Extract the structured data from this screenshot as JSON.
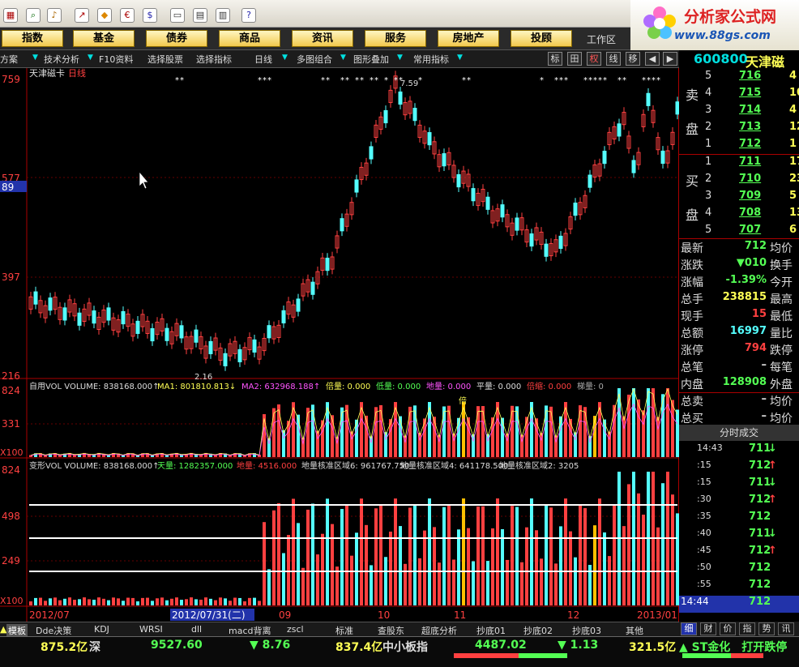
{
  "colors": {
    "up": "#ff4040",
    "down": "#54ffff",
    "ma1": "#ffff55",
    "ma2": "#ff55ff",
    "gold": "#ffc000"
  },
  "logo": {
    "title": "分析家公式网",
    "url": "www.88gs.com"
  },
  "menu": [
    "指数",
    "基金",
    "债券",
    "商品",
    "资讯",
    "服务",
    "房地产",
    "投顾"
  ],
  "workarea": "工作区",
  "tabs": [
    "方案",
    "技术分析",
    "F10资料",
    "选择股票",
    "选择指标",
    "日线",
    "多图组合",
    "图形叠加",
    "常用指标"
  ],
  "tab_tools": [
    "标",
    "田",
    "权",
    "线",
    "移",
    "◀",
    "▶"
  ],
  "stock": {
    "code": "600800",
    "name": "天津磁"
  },
  "chart": {
    "title": "天津磁卡",
    "period": "日线",
    "price_ticks": [
      "759",
      "577",
      "397",
      "216"
    ],
    "price_marker": "89",
    "high_label": "7.59",
    "low_label": "2.16",
    "vol_ticks": [
      "824",
      "331",
      "X100"
    ],
    "vol2_ticks": [
      "824",
      "498",
      "249",
      "X100"
    ],
    "vol_header": [
      "自用VOL VOLUME: 838168.000↑",
      "MA1: 801810.813↓",
      "MA2: 632968.188↑",
      "倍量: 0.000",
      "低量: 0.000",
      "地量: 0.000",
      "平量: 0.000",
      "倍缩: 0.000",
      "梯量: 0"
    ],
    "vol2_header": [
      "变形VOL VOLUME: 838168.000↑",
      "天量: 1282357.000",
      "地量: 4516.000",
      "地量核准区域6: 961767.750",
      "地量核准区域4: 641178.500",
      "地量核准区域2: 3205"
    ],
    "bei_label": "倍",
    "x_labels": [
      "2012/07",
      "2012/07/31(二)",
      "09",
      "10",
      "11",
      "12",
      "2013/01"
    ]
  },
  "orderbook": {
    "sell_label": [
      "卖",
      "盘"
    ],
    "buy_label": [
      "买",
      "盘"
    ],
    "sell": [
      {
        "idx": "5",
        "price": "716",
        "vol": "4"
      },
      {
        "idx": "4",
        "price": "715",
        "vol": "10"
      },
      {
        "idx": "3",
        "price": "714",
        "vol": "4"
      },
      {
        "idx": "2",
        "price": "713",
        "vol": "12"
      },
      {
        "idx": "1",
        "price": "712",
        "vol": "1"
      }
    ],
    "buy": [
      {
        "idx": "1",
        "price": "711",
        "vol": "17"
      },
      {
        "idx": "2",
        "price": "710",
        "vol": "23"
      },
      {
        "idx": "3",
        "price": "709",
        "vol": "5"
      },
      {
        "idx": "4",
        "price": "708",
        "vol": "13"
      },
      {
        "idx": "5",
        "price": "707",
        "vol": "6"
      }
    ]
  },
  "quote": [
    {
      "label": "最新",
      "value": "712",
      "color": "#54ff54",
      "tail": "均价"
    },
    {
      "label": "涨跌",
      "value": "▼010",
      "color": "#54ff54",
      "tail": "换手"
    },
    {
      "label": "涨幅",
      "value": "-1.39%",
      "color": "#54ff54",
      "tail": "今开"
    },
    {
      "label": "总手",
      "value": "238815",
      "color": "#ffff55",
      "tail": "最高"
    },
    {
      "label": "现手",
      "value": "15",
      "color": "#ff4040",
      "tail": "最低"
    },
    {
      "label": "总额",
      "value": "16997",
      "color": "#54ffff",
      "tail": "量比"
    },
    {
      "label": "涨停",
      "value": "794",
      "color": "#ff4040",
      "tail": "跌停"
    },
    {
      "label": "总笔",
      "value": "–",
      "color": "#ddd",
      "tail": "每笔"
    },
    {
      "label": "内盘",
      "value": "128908",
      "color": "#54ff54",
      "tail": "外盘"
    },
    {
      "label": "总卖",
      "value": "–",
      "color": "#ddd",
      "tail": "均价"
    },
    {
      "label": "总买",
      "value": "–",
      "color": "#ddd",
      "tail": "均价"
    }
  ],
  "ticks_title": "分时成交",
  "ticks": [
    {
      "time": "14:43",
      "price": "711",
      "arrow": "↓"
    },
    {
      "time": ":15",
      "price": "712",
      "arrow": "↑"
    },
    {
      "time": ":15",
      "price": "711",
      "arrow": "↓"
    },
    {
      "time": ":30",
      "price": "712",
      "arrow": "↑"
    },
    {
      "time": ":35",
      "price": "712",
      "arrow": ""
    },
    {
      "time": ":40",
      "price": "711",
      "arrow": "↓"
    },
    {
      "time": ":45",
      "price": "712",
      "arrow": "↑"
    },
    {
      "time": ":50",
      "price": "712",
      "arrow": ""
    },
    {
      "time": ":55",
      "price": "712",
      "arrow": ""
    },
    {
      "time": "14:44",
      "price": "712",
      "arrow": ""
    }
  ],
  "bottom_tabs": [
    "模板",
    "Dde决策",
    "KDJ",
    "WRSI",
    "dll",
    "macd背离",
    "zscl",
    "标准",
    "查股东",
    "超底分析",
    "抄底01",
    "抄底02",
    "抄底03",
    "其他"
  ],
  "right_tabs": [
    "细",
    "财",
    "价",
    "指",
    "势",
    "讯"
  ],
  "status": {
    "sh_amount": "875.2亿",
    "sz_label": "深",
    "sz_index": "9527.60",
    "sz_change": "▼ 8.76",
    "sz_amount": "837.4亿",
    "zx_label": "中小板指",
    "zx_index": "4487.02",
    "zx_change": "▼ 1.13",
    "zx_amount": "321.5亿",
    "news": "▲ ST金化　打开跌停"
  }
}
